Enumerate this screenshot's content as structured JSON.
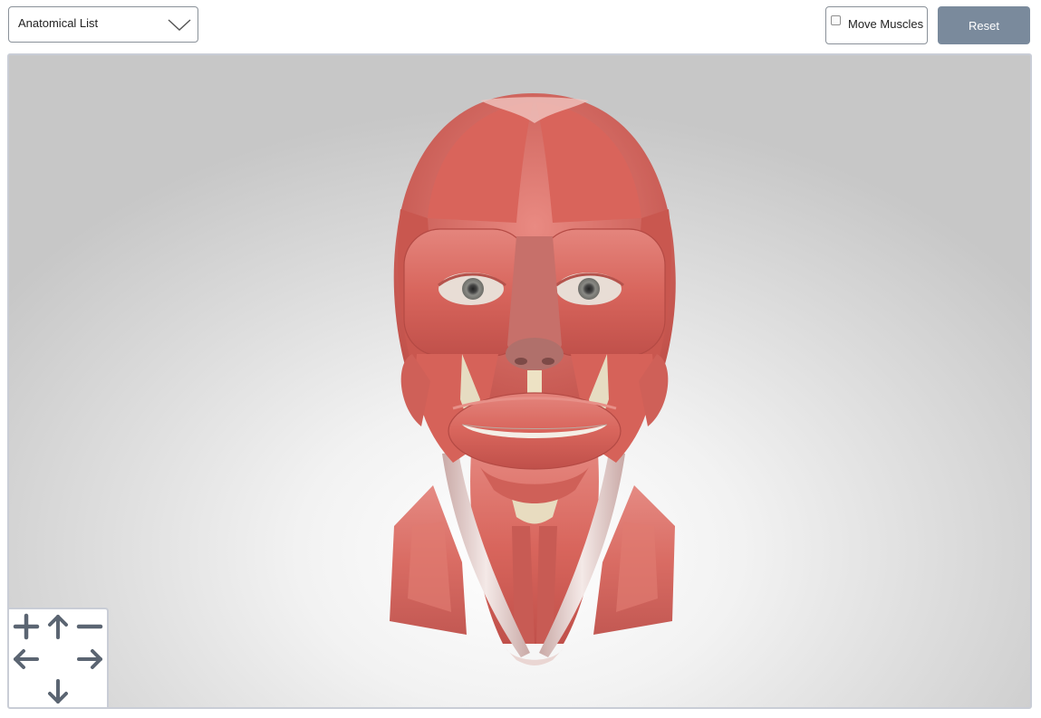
{
  "toolbar": {
    "dropdown_label": "Anatomical List",
    "move_muscles_label": "Move Muscles",
    "move_muscles_checked": false,
    "reset_label": "Reset"
  },
  "viewer": {
    "model": "head-and-neck-muscles"
  },
  "navpad": {
    "buttons": [
      "zoom-in",
      "pan-up",
      "zoom-out",
      "pan-left",
      "pan-right",
      "pan-down"
    ]
  },
  "colors": {
    "reset_bg": "#7a8a9c",
    "border": "#8a9199",
    "nav_icon": "#5b6572",
    "muscle": "#d8655c"
  }
}
